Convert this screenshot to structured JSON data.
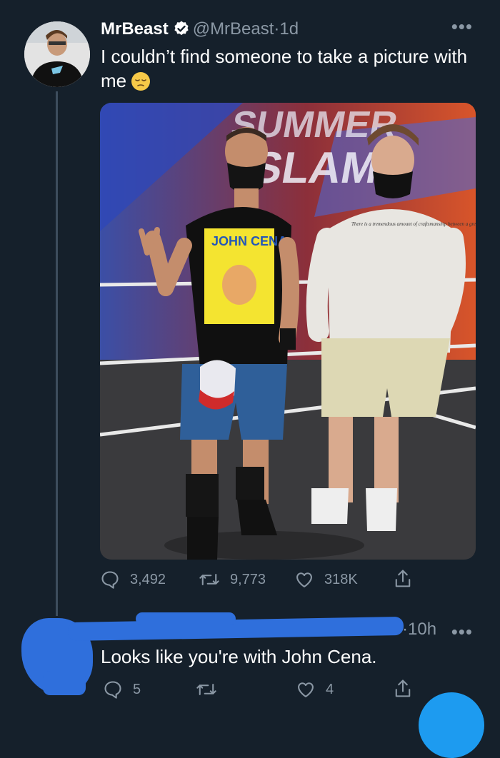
{
  "tweet": {
    "author_name": "MrBeast",
    "handle": "@MrBeast",
    "separator": "·",
    "time": "1d",
    "more_label": "•••",
    "text": "I couldn’t find someone to take a picture with me",
    "emoji": "pensive-face",
    "photo_print_tshirt": "There is a tremendous amount of craftsmanship between a great idea and a great product.",
    "photo_print_shirt_title": "JOHN CENA",
    "photo_print_background": "SUMMER SLAM",
    "stats": {
      "replies": "3,492",
      "retweets": "9,773",
      "likes": "318K"
    }
  },
  "reply": {
    "separator": "·",
    "time": "10h",
    "more_label": "•••",
    "text": "Looks like you're with John Cena.",
    "stats": {
      "replies": "5",
      "likes": "4"
    }
  },
  "colors": {
    "background": "#15202b",
    "muted": "#8b98a5",
    "verified": "#ffffff",
    "redaction": "#2f6fdc",
    "fab": "#1d9bf0"
  }
}
